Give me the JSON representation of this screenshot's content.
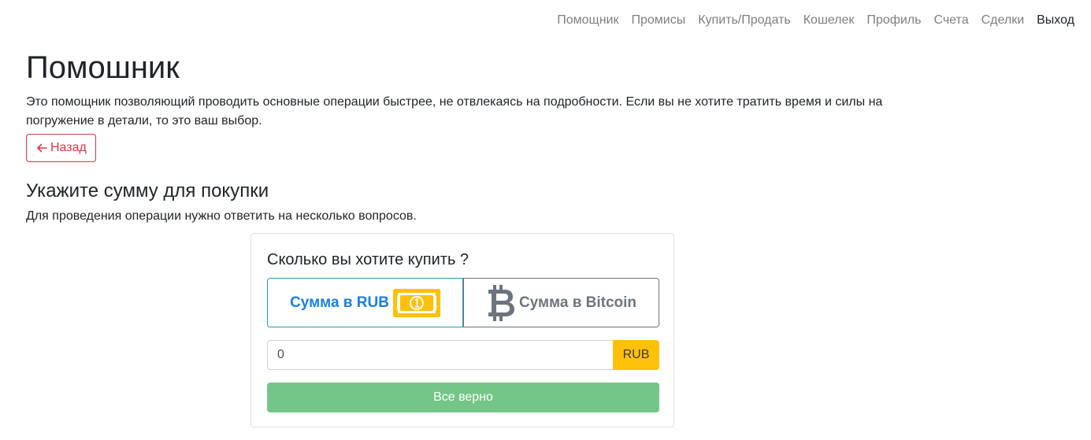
{
  "nav": {
    "items": [
      {
        "label": "Помощник"
      },
      {
        "label": "Промисы"
      },
      {
        "label": "Купить/Продать"
      },
      {
        "label": "Кошелек"
      },
      {
        "label": "Профиль"
      },
      {
        "label": "Счета"
      },
      {
        "label": "Сделки"
      },
      {
        "label": "Выход"
      }
    ]
  },
  "page": {
    "title": "Помошник",
    "description": "Это помощник позволяющий проводить основные операции быстрее, не отвлекаясь на подробности. Если вы не хотите тратить время и силы на погружение в детали, то это ваш выбор.",
    "back_label": "Назад",
    "section_title": "Укажите сумму для покупки",
    "section_subtitle": "Для проведения операции нужно ответить на несколько вопросов."
  },
  "card": {
    "title": "Сколько вы хотите купить ?",
    "toggle_rub_label": "Сумма в RUB",
    "toggle_btc_label": "Сумма в Bitcoin",
    "selected_mode": "RUB",
    "amount_value": "0",
    "currency_addon": "RUB",
    "confirm_label": "Все верно"
  },
  "icons": {
    "back": "arrow-left-icon",
    "rub": "banknote-icon",
    "btc": "bitcoin-icon"
  },
  "colors": {
    "danger": "#dc3545",
    "info": "#17a2b8",
    "warning": "#ffc107",
    "success_disabled": "#74c687",
    "link_active": "#1a7fe0"
  }
}
